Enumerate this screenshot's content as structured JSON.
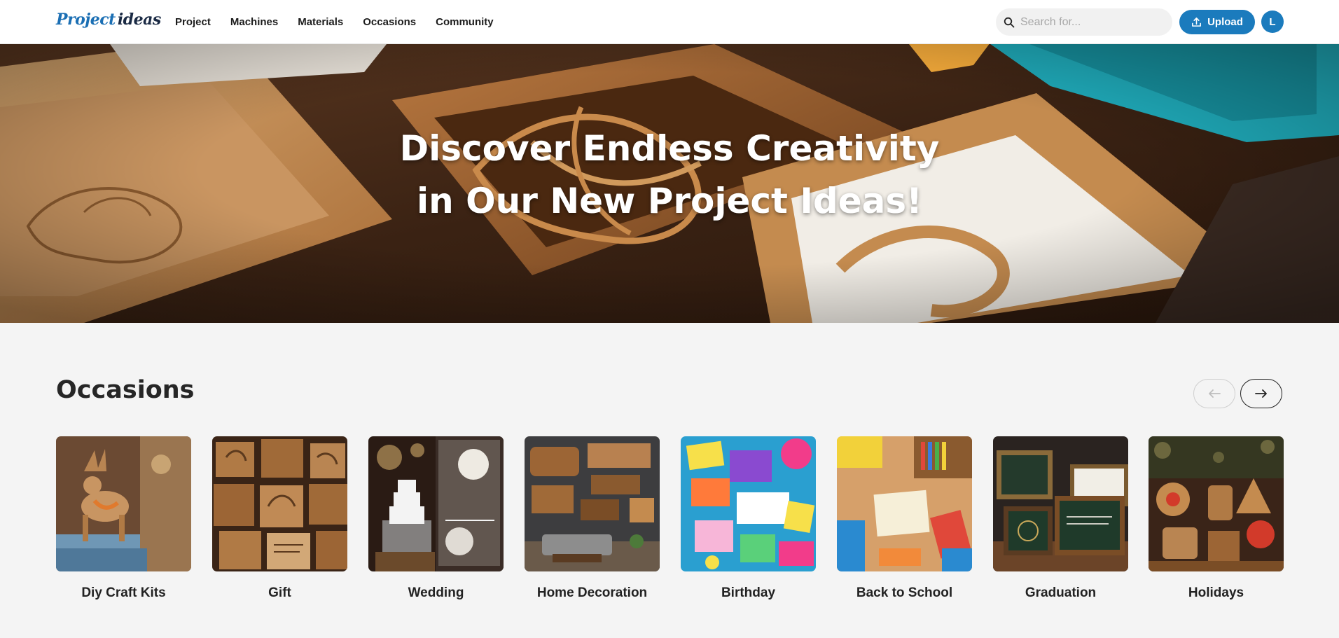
{
  "header": {
    "logo": {
      "part1": "Project",
      "part2": "ideas"
    },
    "nav": [
      "Project",
      "Machines",
      "Materials",
      "Occasions",
      "Community"
    ],
    "search": {
      "placeholder": "Search for..."
    },
    "upload_label": "Upload",
    "avatar_letter": "L"
  },
  "hero": {
    "line1": "Discover Endless Creativity",
    "line2": "in Our New Project Ideas!"
  },
  "occasions": {
    "title": "Occasions",
    "prev_icon": "arrow-left-icon",
    "next_icon": "arrow-right-icon",
    "cards": [
      {
        "label": "Diy Craft Kits",
        "image": "wooden-deer-kit-photo"
      },
      {
        "label": "Gift",
        "image": "engraved-wood-plaques-photo"
      },
      {
        "label": "Wedding",
        "image": "crystal-wedding-cake-photo"
      },
      {
        "label": "Home Decoration",
        "image": "wooden-wall-signs-photo"
      },
      {
        "label": "Birthday",
        "image": "colorful-birthday-cards-photo"
      },
      {
        "label": "Back to School",
        "image": "school-supplies-photo"
      },
      {
        "label": "Graduation",
        "image": "graduation-frames-photo"
      },
      {
        "label": "Holidays",
        "image": "holiday-ornaments-photo"
      }
    ]
  },
  "colors": {
    "brand": "#1b7bbd",
    "logo_blue": "#1b6fb4",
    "page_bg": "#f4f4f4"
  }
}
